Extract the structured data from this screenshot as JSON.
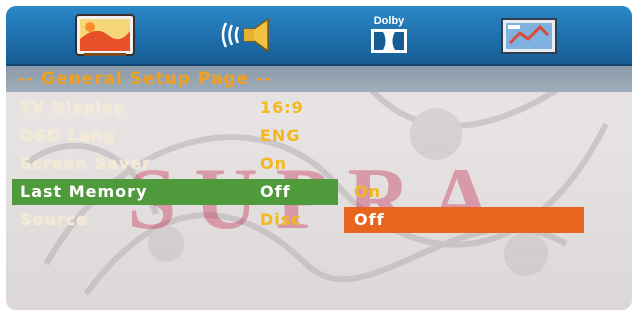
{
  "tabs": [
    {
      "id": "general",
      "icon": "general-setup-icon"
    },
    {
      "id": "audio",
      "icon": "speaker-icon"
    },
    {
      "id": "dolby",
      "icon": "dolby-icon",
      "caption": "Dolby"
    },
    {
      "id": "preference",
      "icon": "preference-icon"
    }
  ],
  "page_title": "-- General Setup Page --",
  "menu": [
    {
      "label": "TV Display",
      "value": "16:9"
    },
    {
      "label": "OSD Lang",
      "value": "ENG"
    },
    {
      "label": "Screen Saver",
      "value": "On"
    },
    {
      "label": "Last Memory",
      "value": "Off",
      "selected": true
    },
    {
      "label": "Source",
      "value": "Disc"
    }
  ],
  "submenu": {
    "options": [
      "On",
      "Off"
    ],
    "active": "Off"
  },
  "watermark": "SUPRA",
  "colors": {
    "icon_bar": "#1e6fac",
    "title_text": "#f0a020",
    "value_text": "#f3b81c",
    "selected_row": "#4f9a3a",
    "active_option": "#e8651e",
    "watermark": "#c42854"
  }
}
